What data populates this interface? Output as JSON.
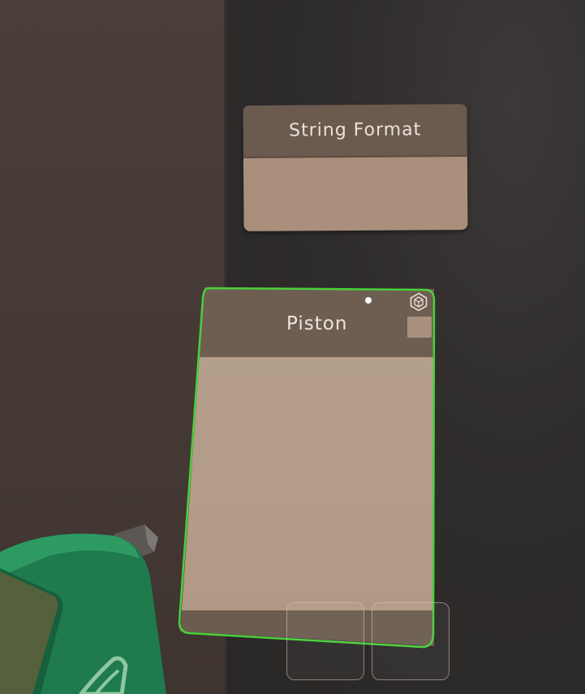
{
  "nodes": {
    "string_format": {
      "title": "String Format"
    },
    "piston": {
      "title": "Piston",
      "selected": true
    }
  },
  "icons": {
    "piston_settings": "hexagon-cube-icon",
    "indicator": "white-dot-icon"
  },
  "colors": {
    "selection_outline": "#49d13a",
    "node_header": "#6b5a4e",
    "node_body": "#a98f7c",
    "tool_body": "#1f7a4e"
  },
  "hotbar": {
    "slot_count": 2
  }
}
